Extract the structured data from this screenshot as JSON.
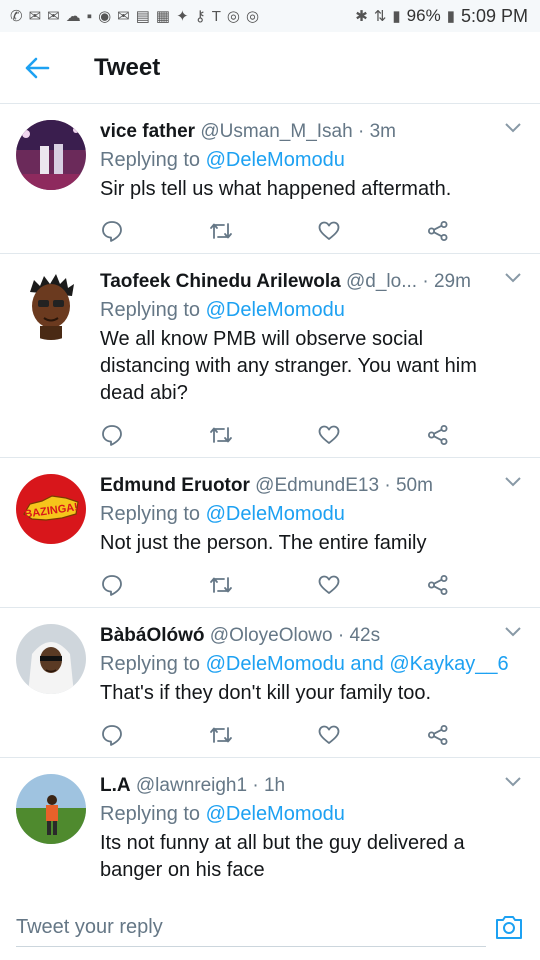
{
  "status_bar": {
    "battery": "96%",
    "time": "5:09 PM"
  },
  "header": {
    "title": "Tweet"
  },
  "colors": {
    "accent": "#1da1f2",
    "muted": "#657786",
    "text": "#14171a"
  },
  "tweets": [
    {
      "name": "vice father",
      "handle": "@Usman_M_Isah",
      "sep": "·",
      "time": "3m",
      "replying_label": "Replying to",
      "mentions": "@DeleMomodu",
      "text": "Sir pls tell us what happened aftermath."
    },
    {
      "name": "Taofeek Chinedu Arilewola",
      "handle": "@d_lo...",
      "sep": "·",
      "time": "29m",
      "replying_label": "Replying to",
      "mentions": "@DeleMomodu",
      "text": "We all know PMB will observe social distancing with any stranger. You want him dead abi?"
    },
    {
      "name": "Edmund Eruotor",
      "handle": "@EdmundE13",
      "sep": "·",
      "time": "50m",
      "replying_label": "Replying to",
      "mentions": "@DeleMomodu",
      "text": "Not just the person. The entire family"
    },
    {
      "name": "BàbáOlówó",
      "handle": "@OloyeOlowo",
      "sep": "·",
      "time": "42s",
      "replying_label": "Replying to",
      "mentions": "@DeleMomodu and @Kaykay__6",
      "text": "That's if they don't kill your family too."
    },
    {
      "name": "L.A",
      "handle": "@lawnreigh1",
      "sep": "·",
      "time": "1h",
      "replying_label": "Replying to",
      "mentions": "@DeleMomodu",
      "text": "Its not funny at all but the guy delivered a banger on his face"
    }
  ],
  "avatars": {
    "edmund_badge_text": "BAZINGA!"
  },
  "reply": {
    "placeholder": "Tweet your reply"
  }
}
